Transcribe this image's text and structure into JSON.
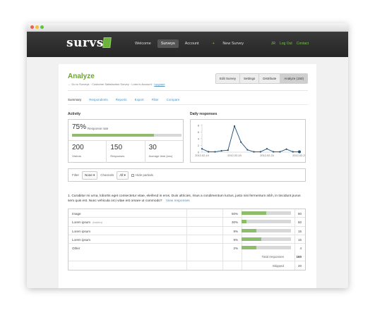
{
  "brand": {
    "logo": "survs"
  },
  "nav": {
    "items": [
      "Welcome",
      "Surveys",
      "Account"
    ],
    "active_index": 1,
    "new_survey": "New Survey"
  },
  "user_nav": {
    "user": "JR",
    "logout": "Log Out",
    "contact": "Contact"
  },
  "page": {
    "title": "Analyze",
    "breadcrumb": {
      "prefix": "← Go to Surveys",
      "survey": "Customer Satisfaction Survey",
      "account": "Loren's Account",
      "upgrade": "Upgrade",
      "sep": "·"
    },
    "actions": [
      "Edit Survey",
      "Settings",
      "Distribute",
      "Analyze (150)"
    ]
  },
  "subtabs": {
    "items": [
      "Summary",
      "Respondents",
      "Reports",
      "Export",
      "Filter",
      "Compare"
    ],
    "active_index": 0
  },
  "activity": {
    "heading": "Activity",
    "response_rate": "75%",
    "response_rate_label": "Response rate",
    "response_rate_value": 0.75,
    "stats": [
      {
        "value": "200",
        "label": "Visitors"
      },
      {
        "value": "150",
        "label": "Responses"
      },
      {
        "value": "30",
        "label": "Average time (sec)"
      }
    ]
  },
  "daily": {
    "heading": "Daily responses"
  },
  "chart_data": {
    "type": "line",
    "x": [
      "2012-02-14",
      "2012-02-15",
      "2012-02-16",
      "2012-02-17",
      "2012-02-18",
      "2012-02-19",
      "2012-02-20",
      "2012-02-21",
      "2012-02-22",
      "2012-02-23",
      "2012-02-24",
      "2012-02-25",
      "2012-02-26",
      "2012-02-27",
      "2012-02-28",
      "2012-02-29"
    ],
    "xticks": [
      "2012-02-14",
      "2012-02-19",
      "2012-02-24",
      "2012-02-29"
    ],
    "values": [
      1,
      0.1,
      0.1,
      0.4,
      0.6,
      7.8,
      3,
      0.7,
      0.1,
      0.1,
      1,
      0.1,
      0.1,
      0.9,
      0.1,
      0.1
    ],
    "yticks": [
      0,
      2,
      4,
      6,
      8
    ],
    "ylim": [
      0,
      8
    ],
    "color": "#1f4e79"
  },
  "filter": {
    "label": "Filter",
    "filter_value": "None",
    "channels_label": "Channels",
    "channels_value": "All",
    "hide_partials": "Hide partials"
  },
  "question": {
    "text": "1. Curabitur mi urna, lobortis eget consectetur vitae, eleifend in eros. Duis ultricies, risus a condimentum luctus, justo nisi fermentum nibh, in tincidunt purus sem quis est. Nunc vehicula orci vitae est ornare ut commodo?",
    "view_link": "View responses"
  },
  "table": {
    "rows": [
      {
        "label": "Image",
        "hidden": "",
        "percent": "50%",
        "fraction": 0.5,
        "count": "80"
      },
      {
        "label": "Lorem ipsum",
        "hidden": "(hidden)",
        "percent": "30%",
        "fraction": 0.1,
        "count": "50"
      },
      {
        "label": "Lorem ipsum",
        "hidden": "",
        "percent": "9%",
        "fraction": 0.3,
        "count": "15"
      },
      {
        "label": "Lorem ipsum",
        "hidden": "",
        "percent": "9%",
        "fraction": 0.4,
        "count": "15"
      },
      {
        "label": "Other",
        "hidden": "",
        "percent": "2%",
        "fraction": 0.3,
        "count": "4"
      }
    ],
    "total_label": "Total responses",
    "total_value": "160",
    "skipped_label": "Skipped",
    "skipped_value": "20"
  },
  "colors": {
    "accent": "#6ea13b",
    "bar": "#8dbd6a",
    "link": "#4a90c2",
    "chart_line": "#1f4e79"
  }
}
